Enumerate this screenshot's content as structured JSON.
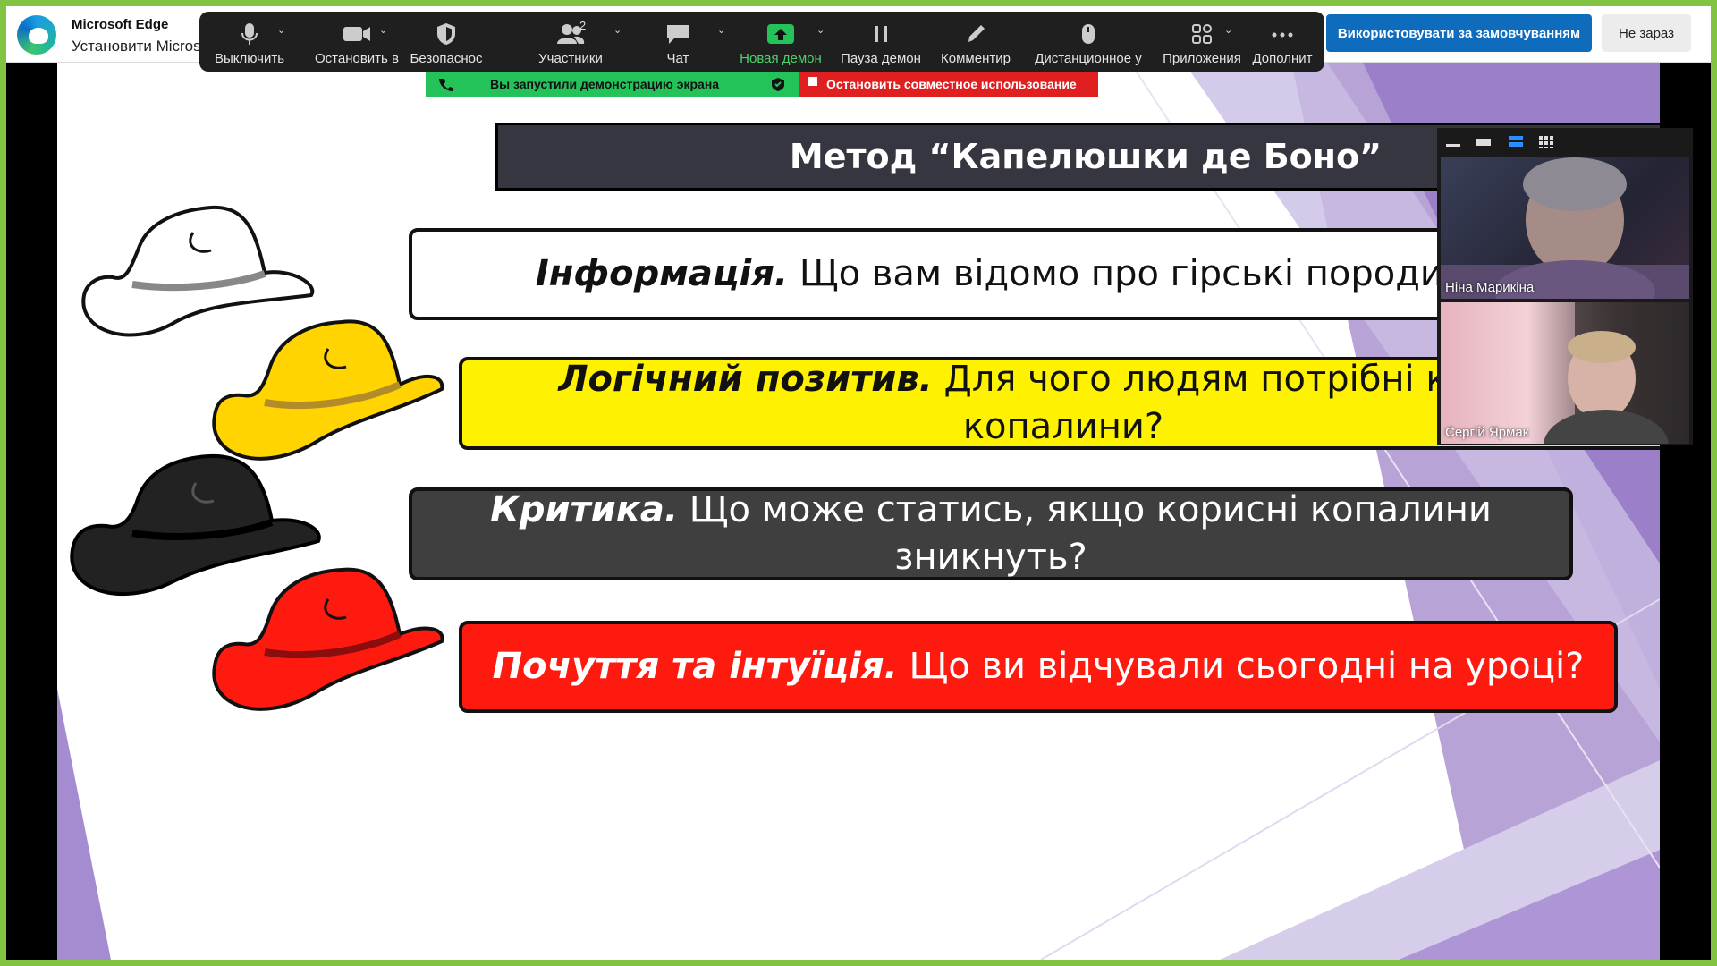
{
  "edge_bar": {
    "title": "Microsoft Edge",
    "subtitle": "Установити Microsoft",
    "primary_button": "Використовувати за замовчуванням",
    "secondary_button": "Не зараз"
  },
  "zoom_toolbar": {
    "items": [
      {
        "label": "Выключить",
        "icon": "microphone-icon"
      },
      {
        "label": "Остановить в",
        "icon": "video-camera-icon"
      },
      {
        "label": "Безопаснос",
        "icon": "shield-icon"
      },
      {
        "label": "Участники",
        "icon": "participants-icon",
        "count": "2"
      },
      {
        "label": "Чат",
        "icon": "chat-icon"
      },
      {
        "label": "Новая демон",
        "icon": "share-screen-icon"
      },
      {
        "label": "Пауза демон",
        "icon": "pause-icon"
      },
      {
        "label": "Комментир",
        "icon": "pencil-icon"
      },
      {
        "label": "Дистанционное у",
        "icon": "mouse-icon"
      },
      {
        "label": "Приложения",
        "icon": "apps-icon"
      },
      {
        "label": "Дополнит",
        "icon": "more-icon"
      }
    ]
  },
  "share_banner": {
    "message": "Вы запустили демонстрацию экрана",
    "stop_label": "Остановить совместное использование"
  },
  "slide": {
    "title": "Метод “Капелюшки де Боно”",
    "questions": [
      {
        "bold": "Інформація.",
        "text": " Що вам відомо про гірські породи?",
        "color": "white"
      },
      {
        "bold": "Логічний позитив.",
        "text": " Для чого людям потрібні корисні копалини?",
        "color": "yellow"
      },
      {
        "bold": "Критика.",
        "text": " Що може статись, якщо корисні копалини зникнуть?",
        "color": "black"
      },
      {
        "bold": "Почуття та інтуїція.",
        "text": " Що ви відчували сьогодні на уроці?",
        "color": "red"
      }
    ]
  },
  "participants": [
    {
      "name": "Ніна Марикіна"
    },
    {
      "name": "Сергій Ярмак"
    }
  ],
  "colors": {
    "share_border": "#82c341",
    "toolbar_bg": "#1f1f1f",
    "edge_primary": "#0f6cbd",
    "yellow_hat": "#ffd400",
    "red_hat": "#ff1a10"
  }
}
